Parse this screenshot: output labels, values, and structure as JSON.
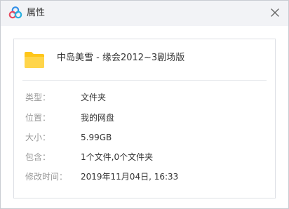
{
  "window": {
    "title": "属性",
    "icon": "baidu-netdisk-logo-icon",
    "close_icon": "close-icon"
  },
  "item": {
    "icon": "folder-icon",
    "name": "中岛美雪 - 缘会2012~3剧场版"
  },
  "properties": [
    {
      "label": "类型：",
      "value": "文件夹"
    },
    {
      "label": "位置：",
      "value": "我的网盘"
    },
    {
      "label": "大小：",
      "value": "5.99GB"
    },
    {
      "label": "包含：",
      "value": "1个文件,0个文件夹"
    },
    {
      "label": "修改时间：",
      "value": "2019年11月04日, 16:33"
    }
  ],
  "colors": {
    "titlebar_bg": "#f2f3f6",
    "folder_yellow": "#ffc61a",
    "label_gray": "#999999",
    "text_dark": "#333333"
  }
}
